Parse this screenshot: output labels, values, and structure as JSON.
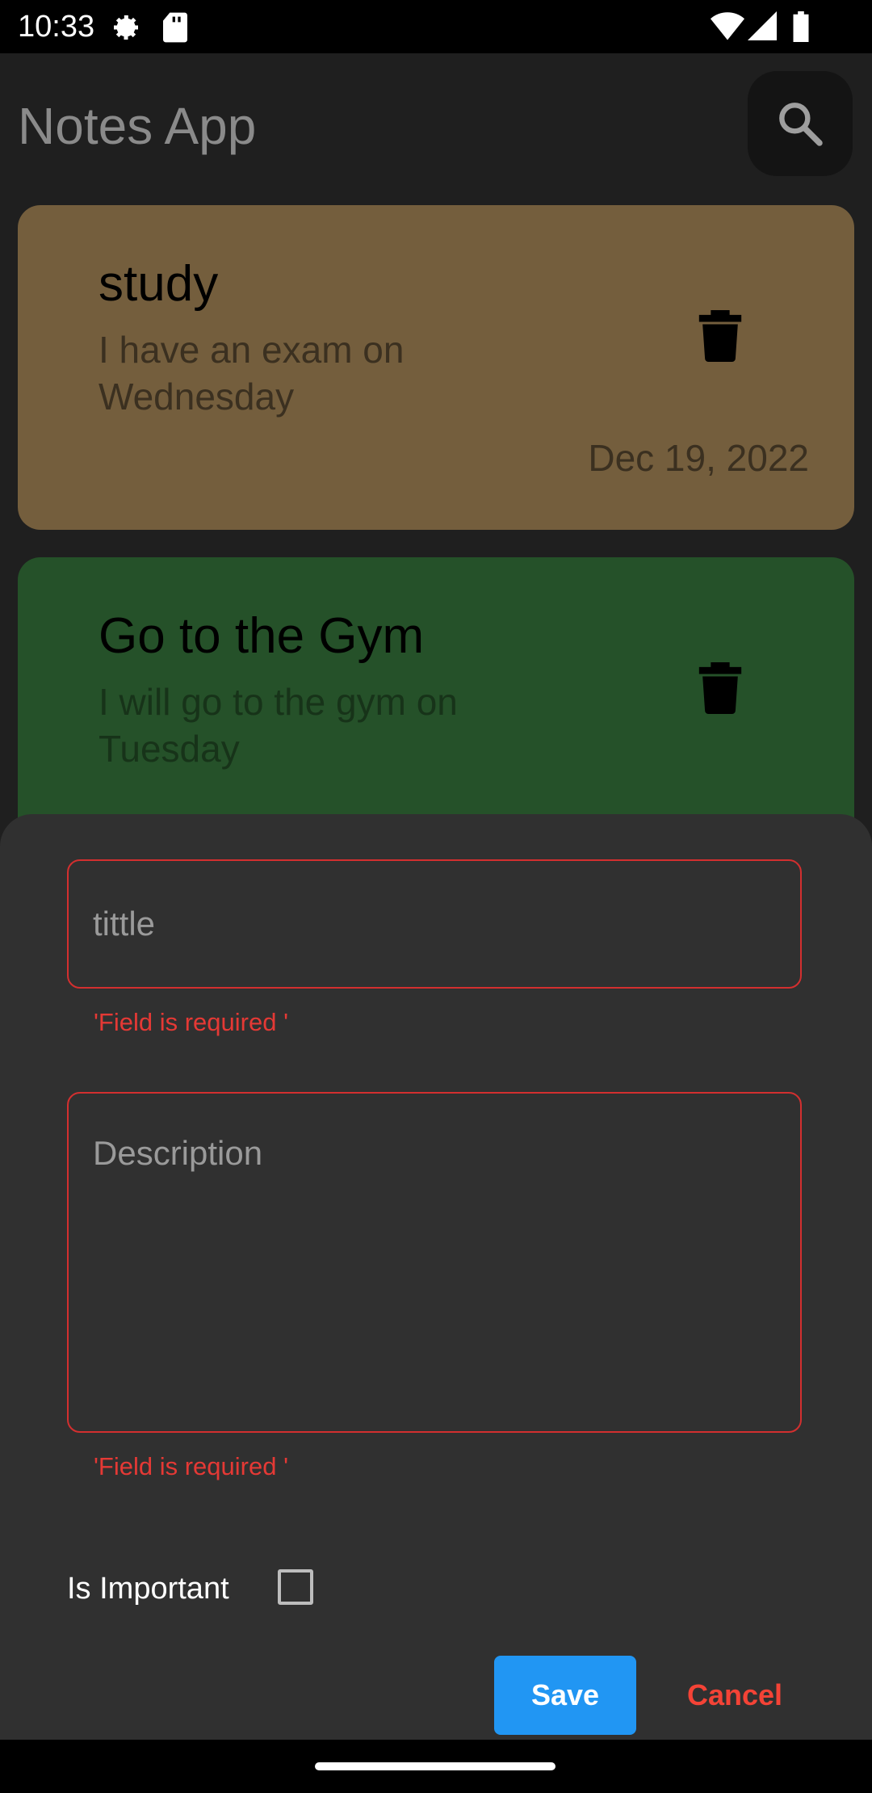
{
  "status_bar": {
    "time": "10:33"
  },
  "header": {
    "title": "Notes App",
    "search_icon": "search-icon"
  },
  "notes": [
    {
      "title": "study",
      "description": "I have an exam on Wednesday",
      "date": "Dec 19, 2022",
      "color": "#745e3d"
    },
    {
      "title": "Go to the Gym",
      "description": "I will go to the gym on Tuesday",
      "color": "#255129"
    }
  ],
  "sheet": {
    "title_placeholder": "tittle",
    "title_error": "'Field is required '",
    "description_placeholder": "Description",
    "description_error": "'Field is required '",
    "important_label": "Is Important",
    "save_label": "Save",
    "cancel_label": "Cancel"
  },
  "colors": {
    "accent": "#2196f3",
    "error": "#d32f2f",
    "cancel": "#f44336"
  }
}
